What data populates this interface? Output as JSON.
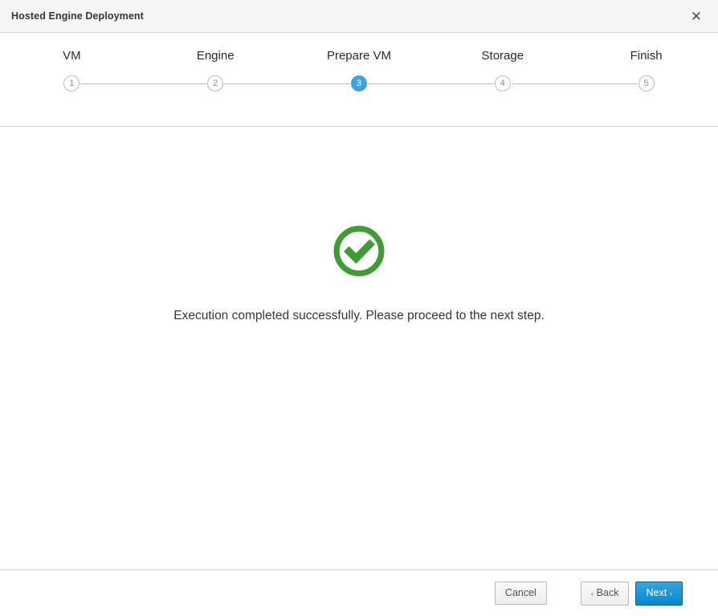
{
  "window": {
    "title": "Hosted Engine Deployment",
    "close_icon": "close-icon",
    "close_glyph": "✕"
  },
  "wizard": {
    "current_step": 3,
    "steps": [
      {
        "number": "1",
        "label": "VM"
      },
      {
        "number": "2",
        "label": "Engine"
      },
      {
        "number": "3",
        "label": "Prepare VM"
      },
      {
        "number": "4",
        "label": "Storage"
      },
      {
        "number": "5",
        "label": "Finish"
      }
    ]
  },
  "content": {
    "status_icon": "check-circle-icon",
    "status_color": "#3f9c35",
    "message": "Execution completed successfully. Please proceed to the next step."
  },
  "footer": {
    "cancel_label": "Cancel",
    "back_label": "Back",
    "back_chevron": "‹",
    "next_label": "Next",
    "next_chevron": "›"
  },
  "colors": {
    "accent_blue": "#0088ce",
    "step_active_blue": "#39a5dc",
    "success_green": "#3f9c35",
    "border_gray": "#d1d1d1",
    "titlebar_bg": "#f5f5f5"
  }
}
